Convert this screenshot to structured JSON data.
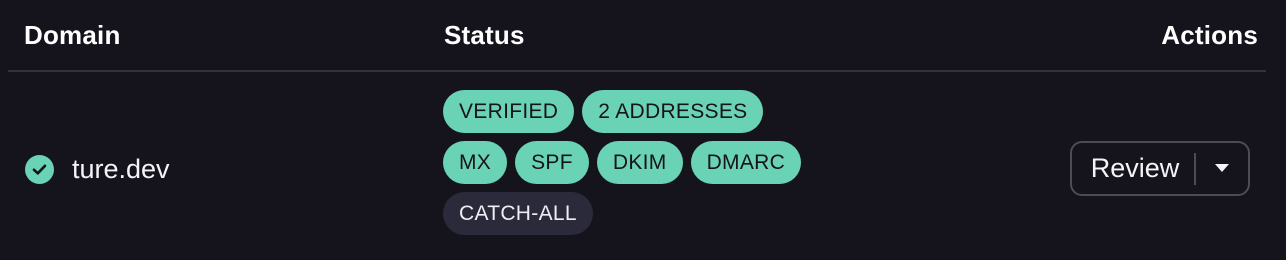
{
  "table": {
    "headers": {
      "domain": "Domain",
      "status": "Status",
      "actions": "Actions"
    },
    "row": {
      "domain": "ture.dev",
      "domain_icon": "check-circle-icon",
      "status_badges": {
        "verified": "VERIFIED",
        "addresses": "2 ADDRESSES",
        "mx": "MX",
        "spf": "SPF",
        "dkim": "DKIM",
        "dmarc": "DMARC",
        "catch_all": "CATCH-ALL"
      },
      "actions": {
        "review_label": "Review",
        "dropdown_icon": "caret-down-icon"
      }
    }
  },
  "colors": {
    "background": "#15131c",
    "accent": "#6ad3b6",
    "muted_badge": "#2b2a3b",
    "border": "#34313f"
  }
}
